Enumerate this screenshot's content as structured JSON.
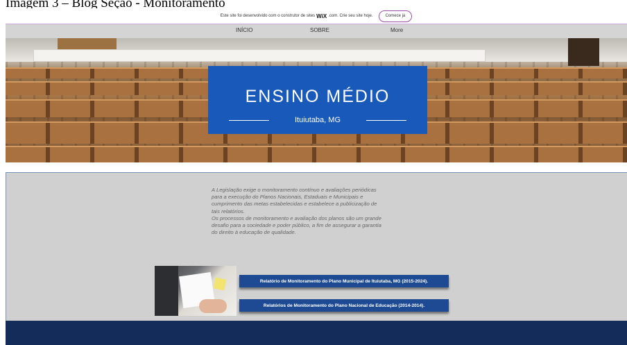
{
  "caption": "Imagem 3 – Blog Seção - Monitoramento",
  "wix_banner": {
    "text_before": "Este site foi desenvolvido com o construtor de sites",
    "brand": "WiX",
    "text_after": ".com. Crie seu site hoje.",
    "cta_label": "Comece já"
  },
  "nav": {
    "items": [
      "INÍCIO",
      "SOBRE",
      "More"
    ]
  },
  "hero": {
    "title": "ENSINO MÉDIO",
    "subtitle": "Ituiutaba, MG"
  },
  "content": {
    "paragraph_lines": [
      "A Legislação exige o monitoramento contínuo e avaliações periódicas",
      "para a execução do Planos Nacionais, Estaduais e Municipais  e",
      "cumprimento das metas estabelecidas e estabelece a publicização de",
      "tais relatórios.",
      "Os processos de monitoramento e avaliação dos  planos são um grande",
      "desafio para a sociedade e poder público, a fim de assegurar a garantia",
      "do direito à educação de qualidade."
    ],
    "links": [
      "Relatório de Monitoramento do Plano Municipal de Ituiutaba, MG (2015-2024).",
      "Relatórios de Monitoramento do Plano Nacional de Educação (2014-2014)."
    ]
  },
  "colors": {
    "hero_panel": "#1859ba",
    "link_buttons": "#1d4a93",
    "footer": "#132c5a",
    "content_bg": "#d0d0d0"
  }
}
